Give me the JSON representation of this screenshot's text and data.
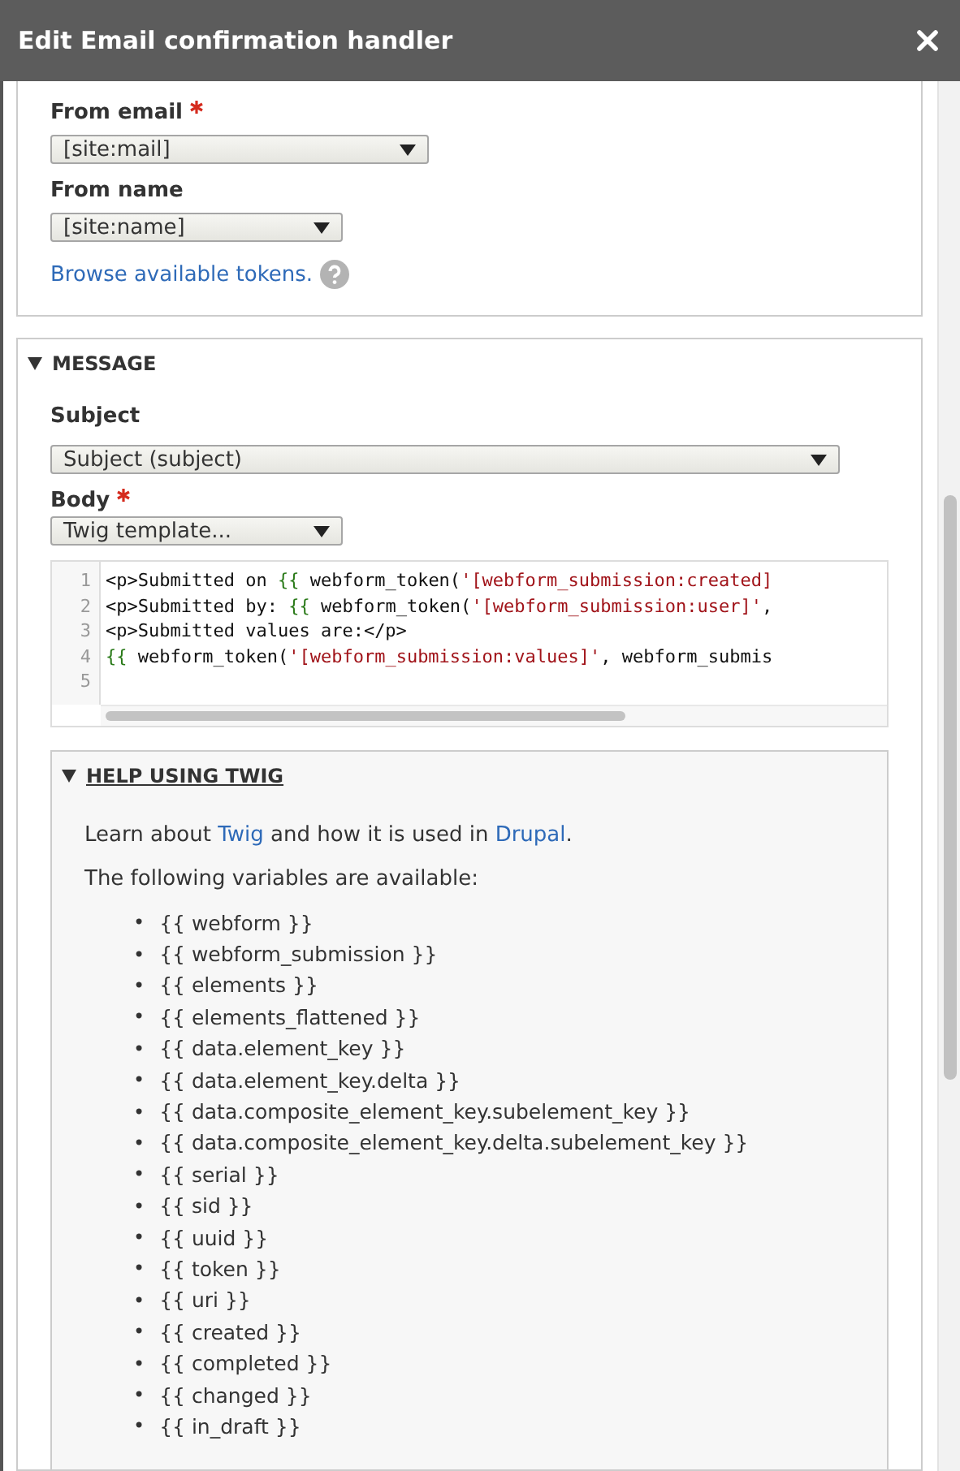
{
  "dialog": {
    "title": "Edit Email confirmation handler"
  },
  "from_section": {
    "fields": [
      {
        "label": "From email",
        "required": true,
        "value": "[site:mail]"
      },
      {
        "label": "From name",
        "required": false,
        "value": "[site:name]"
      }
    ],
    "tokens_link": "Browse available tokens."
  },
  "message_section": {
    "title": "MESSAGE",
    "expanded": true,
    "subject": {
      "label": "Subject",
      "required": false,
      "value": "Subject (subject)"
    },
    "body": {
      "label": "Body",
      "required": true,
      "value": "Twig template..."
    },
    "code_lines": [
      {
        "number": "1",
        "segments": [
          {
            "kind": "plain",
            "text": "<p>Submitted on "
          },
          {
            "kind": "brace",
            "text": "{{"
          },
          {
            "kind": "plain",
            "text": " webform_token("
          },
          {
            "kind": "string",
            "text": "'[webform_submission:created]"
          }
        ]
      },
      {
        "number": "2",
        "segments": [
          {
            "kind": "plain",
            "text": "<p>Submitted by: "
          },
          {
            "kind": "brace",
            "text": "{{"
          },
          {
            "kind": "plain",
            "text": " webform_token("
          },
          {
            "kind": "string",
            "text": "'[webform_submission:user]'"
          },
          {
            "kind": "plain",
            "text": ","
          }
        ]
      },
      {
        "number": "3",
        "segments": [
          {
            "kind": "plain",
            "text": "<p>Submitted values are:</p>"
          }
        ]
      },
      {
        "number": "4",
        "segments": [
          {
            "kind": "brace",
            "text": "{{"
          },
          {
            "kind": "plain",
            "text": " webform_token("
          },
          {
            "kind": "string",
            "text": "'[webform_submission:values]'"
          },
          {
            "kind": "plain",
            "text": ", webform_submis"
          }
        ]
      },
      {
        "number": "5"
      }
    ],
    "help": {
      "title": "HELP USING TWIG",
      "expanded": true,
      "intro": [
        {
          "kind": "text",
          "text": "Learn about "
        },
        {
          "kind": "link",
          "text": "Twig"
        },
        {
          "kind": "text",
          "text": " and how it is used in "
        },
        {
          "kind": "link",
          "text": "Drupal"
        },
        {
          "kind": "text",
          "text": "."
        }
      ],
      "variables_intro": "The following variables are available:",
      "bullet": "•",
      "variables": [
        "{{ webform }}",
        "{{ webform_submission }}",
        "{{ elements }}",
        "{{ elements_flattened }}",
        "{{ data.element_key }}",
        "{{ data.element_key.delta }}",
        "{{ data.composite_element_key.subelement_key }}",
        "{{ data.composite_element_key.delta.subelement_key }}",
        "{{ serial }}",
        "{{ sid }}",
        "{{ uuid }}",
        "{{ token }}",
        "{{ uri }}",
        "{{ created }}",
        "{{ completed }}",
        "{{ changed }}",
        "{{ in_draft }}"
      ]
    }
  }
}
